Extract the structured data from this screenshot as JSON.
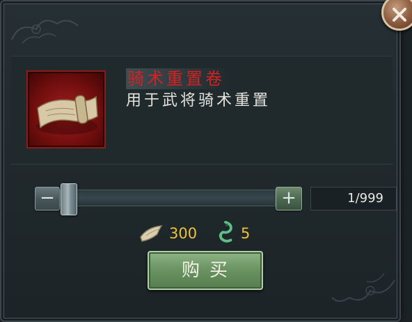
{
  "item": {
    "icon": "scroll-icon",
    "name": "骑术重置卷",
    "description": "用于武将骑术重置"
  },
  "quantity": {
    "slider_fraction": 0.001,
    "minus_symbol": "−",
    "plus_symbol": "+",
    "display": "1/999"
  },
  "cost": {
    "horn_icon": "horn-icon",
    "horn_amount": "300",
    "jade_icon": "jade-dragon-icon",
    "jade_amount": "5"
  },
  "buy_button_label": "购买",
  "colors": {
    "item_name": "#d32222",
    "cost_text": "#f0c23a",
    "buy_button": "#6c9563"
  }
}
